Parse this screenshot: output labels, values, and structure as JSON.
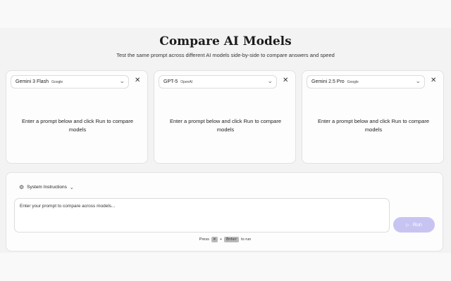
{
  "header": {
    "title": "Compare AI Models",
    "subtitle": "Test the same prompt across different AI models side-by-side to compare answers and speed"
  },
  "cards": [
    {
      "model": "Gemini 3 Flash",
      "provider": "Google",
      "message": "Enter a prompt below and click Run to compare models"
    },
    {
      "model": "GPT-5",
      "provider": "OpenAI",
      "message": "Enter a prompt below and click Run to compare models"
    },
    {
      "model": "Gemini 2.5 Pro",
      "provider": "Google",
      "message": "Enter a prompt below and click Run to compare models"
    }
  ],
  "icons": {
    "chevron": "chevron-down-icon",
    "close": "close-icon",
    "gear": "gear-icon",
    "play": "play-icon"
  },
  "composer": {
    "system_instructions_label": "System Instructions",
    "prompt_placeholder": "Enter your prompt to compare across models...",
    "run_label": "Run",
    "hint_press": "Press",
    "hint_key_cmd": "⌘",
    "hint_plus": "+",
    "hint_key_enter": "Enter",
    "hint_suffix": "to run"
  },
  "colors": {
    "run_button": "#c8c4f2",
    "background": "#f3f3f3",
    "card": "#fdfdfd"
  }
}
